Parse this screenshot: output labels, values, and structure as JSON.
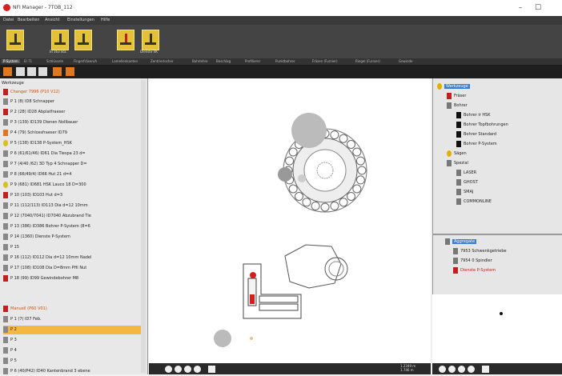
{
  "window": {
    "title": "NFI Manager - 7TOB_112"
  },
  "menu": [
    "Datei",
    "Bearbeiten",
    "Ansicht",
    "Einstellungen",
    "Hilfe"
  ],
  "tools": [
    {
      "label": "",
      "red": false
    },
    {
      "label": "EI 163 Sta.",
      "red": false
    },
    {
      "label": "",
      "red": false
    },
    {
      "label": "",
      "red": true
    },
    {
      "label": "Dienste VK",
      "red": false
    }
  ],
  "tabs": [
    "P-System",
    "EI 71",
    "Schlüsseln",
    "Fingerfräsen/A",
    "Lamellenkanten",
    "Zentrierlocher",
    "Bohrlehre",
    "Beschlag",
    "Profilierer",
    "Punktbohrer",
    "Fräsen (Furnier)",
    "Riegel (Furnier)",
    "Gewinde"
  ],
  "left_panel": {
    "header": "Werkzeuge",
    "group1": "Changer 7996 (P10 V12)",
    "items1": [
      "P 1 (8) ID8 Schnapper",
      "P 2 (28) ID28 Abplatfraeser",
      "P 3 (139) ID139 Dienen Nollbauer",
      "P 4 (79) Schlossfraeser ID79",
      "P 5 (138) ID138 P-System_HSK",
      "P 6 (61/61/46) ID61 Dia Tiespa 23 d=",
      "P 7 (4/40 /62) 3D Typ 4 Schnapper D=",
      "P 8 (66/49/4) ID66 Hut 21 d=4",
      "P 9 (681) ID681 HSK Lauco 18 D=300",
      "P 10 (103) ID103 Hut d=3",
      "P 11 (112/113) ID113 Dia d=12 10mm",
      "P 12 (7040/7041) ID7040 Abzubrand Tie",
      "P 13 (386) ID386 Bohrer P-System (8=6",
      "P 14 (1360) Dienste P-System",
      "P 15",
      "P 16 (112) ID112 Dia d=12 10mm Nadel",
      "P 17 (108) ID108 Dia D=8mm PHI Nut",
      "P 18 (99) ID99 Gewindebohrer M8"
    ],
    "group2": "Manuell (P60 V01)",
    "items2": [
      "P 1 (7) ID7 Feb.",
      "P 2",
      "P 3",
      "P 4",
      "P 5",
      "P 6 (40/P42) ID40 Kantenbrand 3 ebene"
    ],
    "selected_item": "P 2"
  },
  "canvas": {
    "coords": "1.2349 m\n1.746 m"
  },
  "right_panel": {
    "tree": [
      {
        "label": "Werkzeuge",
        "selected": true,
        "icon": "yellow",
        "indent": 0
      },
      {
        "label": "Fräser",
        "icon": "red",
        "indent": 1
      },
      {
        "label": "Bohrer",
        "icon": "gray",
        "indent": 1
      },
      {
        "label": "Bohrer ir HSK",
        "icon": "black",
        "indent": 2
      },
      {
        "label": "Bohrer Topfbohrungen",
        "icon": "black",
        "indent": 2
      },
      {
        "label": "Bohrer Standard",
        "icon": "black",
        "indent": 2
      },
      {
        "label": "Bohrer P-System",
        "icon": "black",
        "indent": 2
      },
      {
        "label": "Sägen",
        "icon": "yellow",
        "indent": 1
      },
      {
        "label": "Spezial",
        "icon": "gray",
        "indent": 1
      },
      {
        "label": "LASER",
        "icon": "gray",
        "indent": 2
      },
      {
        "label": "GHOST",
        "icon": "gray",
        "indent": 2
      },
      {
        "label": "SMAJ",
        "icon": "gray",
        "indent": 2
      },
      {
        "label": "COMMONLINE",
        "icon": "gray",
        "indent": 2
      }
    ],
    "aggregates_title": "Aggregate",
    "aggregates": [
      {
        "label": "7953 Schwenkgetriebe",
        "icon": "gray"
      },
      {
        "label": "7954 0 Spindler",
        "icon": "gray"
      },
      {
        "label": "Dienste P-System",
        "icon": "red"
      }
    ]
  },
  "colors": {
    "accent_orange": "#f4b840",
    "selection_blue": "#3a7bd5",
    "tool_yellow": "#e3c13a"
  }
}
